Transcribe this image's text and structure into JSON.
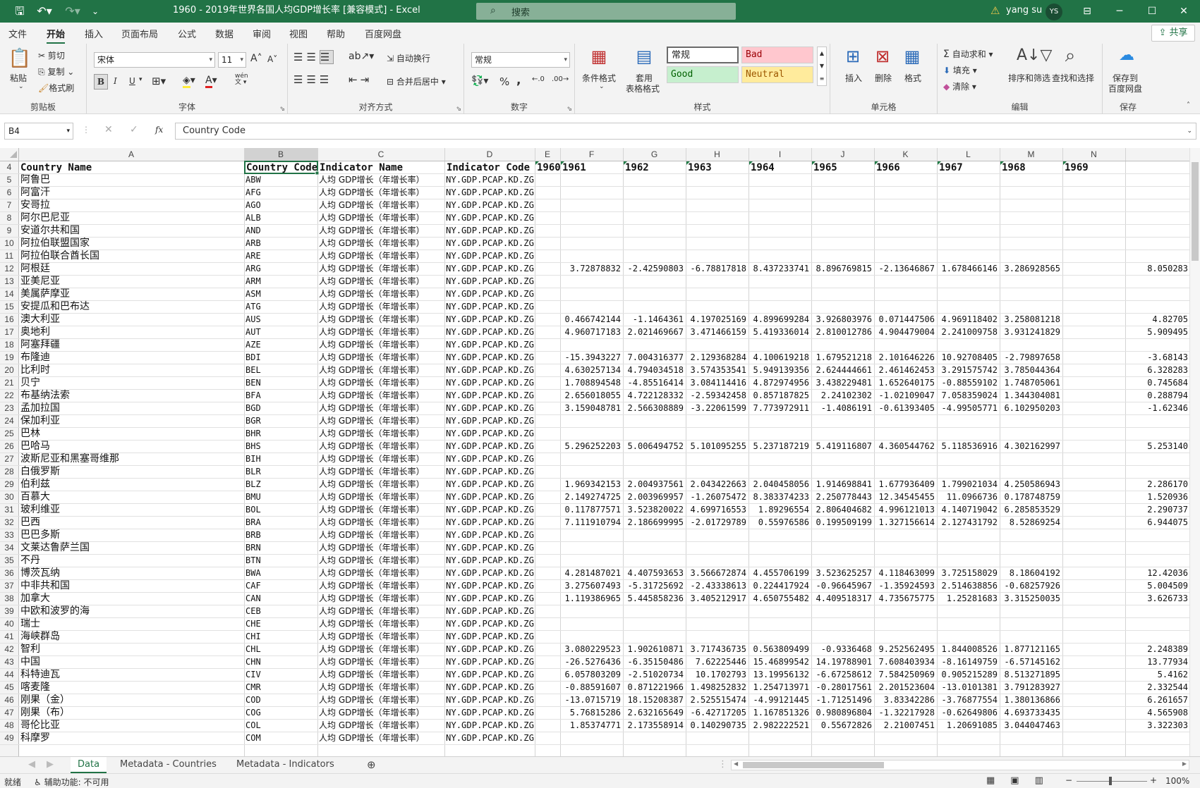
{
  "window": {
    "title": "1960 - 2019年世界各国人均GDP增长率  [兼容模式]  -  Excel",
    "search_placeholder": "搜索",
    "user_name": "yang su",
    "user_initials": "YS"
  },
  "ribbon_tabs": [
    "文件",
    "开始",
    "插入",
    "页面布局",
    "公式",
    "数据",
    "审阅",
    "视图",
    "帮助",
    "百度网盘"
  ],
  "share_label": "共享",
  "clipboard": {
    "paste": "粘贴",
    "cut": "剪切",
    "copy": "复制",
    "format_painter": "格式刷",
    "group": "剪贴板"
  },
  "font": {
    "name": "宋体",
    "size": "11",
    "group": "字体",
    "bold": "B",
    "italic": "I",
    "underline": "U",
    "wen": "wén"
  },
  "align": {
    "wrap": "自动换行",
    "merge": "合并后居中",
    "group": "对齐方式"
  },
  "number": {
    "format": "常规",
    "group": "数字",
    "percent": "%",
    "comma": ","
  },
  "styles": {
    "cond": "条件格式",
    "table1": "套用",
    "table2": "表格格式",
    "normal": "常规",
    "bad": "Bad",
    "good": "Good",
    "neutral": "Neutral",
    "group": "样式"
  },
  "cells": {
    "insert": "插入",
    "delete": "删除",
    "format": "格式",
    "group": "单元格"
  },
  "editing": {
    "autosum": "自动求和",
    "fill": "填充",
    "clear": "清除",
    "sort": "排序和筛选",
    "find": "查找和选择",
    "group": "编辑"
  },
  "save": {
    "l1": "保存到",
    "l2": "百度网盘",
    "group": "保存"
  },
  "formula": {
    "namebox": "B4",
    "fx": "fx",
    "content": "Country Code"
  },
  "colors": {
    "accent": "#217346"
  },
  "columns": [
    "A",
    "B",
    "C",
    "D",
    "E",
    "F",
    "G",
    "H",
    "I",
    "J",
    "K",
    "L",
    "M",
    "N"
  ],
  "header_row": {
    "num": "4",
    "cells": [
      "Country Name",
      "Country Code",
      "Indicator Name",
      "Indicator Code",
      "1960",
      "1961",
      "1962",
      "1963",
      "1964",
      "1965",
      "1966",
      "1967",
      "1968",
      "1969"
    ]
  },
  "indicator_name": "人均 GDP增长（年增长率）",
  "indicator_code": "NY.GDP.PCAP.KD.ZG",
  "rows": [
    {
      "n": "5",
      "name": "阿鲁巴",
      "code": "ABW",
      "v": []
    },
    {
      "n": "6",
      "name": "阿富汗",
      "code": "AFG",
      "v": []
    },
    {
      "n": "7",
      "name": "安哥拉",
      "code": "AGO",
      "v": []
    },
    {
      "n": "8",
      "name": "阿尔巴尼亚",
      "code": "ALB",
      "v": []
    },
    {
      "n": "9",
      "name": "安道尔共和国",
      "code": "AND",
      "v": []
    },
    {
      "n": "10",
      "name": "阿拉伯联盟国家",
      "code": "ARB",
      "v": []
    },
    {
      "n": "11",
      "name": "阿拉伯联合酋长国",
      "code": "ARE",
      "v": []
    },
    {
      "n": "12",
      "name": "阿根廷",
      "code": "ARG",
      "v": [
        "3.72878832",
        "-2.42590803",
        "-6.78817818",
        "8.437233741",
        "8.896769815",
        "-2.13646867",
        "1.678466146",
        "3.286928565",
        "8.050283"
      ]
    },
    {
      "n": "13",
      "name": "亚美尼亚",
      "code": "ARM",
      "v": []
    },
    {
      "n": "14",
      "name": "美属萨摩亚",
      "code": "ASM",
      "v": []
    },
    {
      "n": "15",
      "name": "安提瓜和巴布达",
      "code": "ATG",
      "v": []
    },
    {
      "n": "16",
      "name": "澳大利亚",
      "code": "AUS",
      "v": [
        "0.466742144",
        "-1.1464361",
        "4.197025169",
        "4.899699284",
        "3.926803976",
        "0.071447506",
        "4.969118402",
        "3.258081218",
        "4.82705"
      ]
    },
    {
      "n": "17",
      "name": "奥地利",
      "code": "AUT",
      "v": [
        "4.960717183",
        "2.021469667",
        "3.471466159",
        "5.419336014",
        "2.810012786",
        "4.904479004",
        "2.241009758",
        "3.931241829",
        "5.909495"
      ]
    },
    {
      "n": "18",
      "name": "阿塞拜疆",
      "code": "AZE",
      "v": []
    },
    {
      "n": "19",
      "name": "布隆迪",
      "code": "BDI",
      "v": [
        "-15.3943227",
        "7.004316377",
        "2.129368284",
        "4.100619218",
        "1.679521218",
        "2.101646226",
        "10.92708405",
        "-2.79897658",
        "-3.68143"
      ]
    },
    {
      "n": "20",
      "name": "比利时",
      "code": "BEL",
      "v": [
        "4.630257134",
        "4.794034518",
        "3.574353541",
        "5.949139356",
        "2.624444661",
        "2.461462453",
        "3.291575742",
        "3.785044364",
        "6.328283"
      ]
    },
    {
      "n": "21",
      "name": "贝宁",
      "code": "BEN",
      "v": [
        "1.708894548",
        "-4.85516414",
        "3.084114416",
        "4.872974956",
        "3.438229481",
        "1.652640175",
        "-0.88559102",
        "1.748705061",
        "0.745684"
      ]
    },
    {
      "n": "22",
      "name": "布基纳法索",
      "code": "BFA",
      "v": [
        "2.656018055",
        "4.722128332",
        "-2.59342458",
        "0.857187825",
        "2.24102302",
        "-1.02109047",
        "7.058359024",
        "1.344304081",
        "0.288794"
      ]
    },
    {
      "n": "23",
      "name": "孟加拉国",
      "code": "BGD",
      "v": [
        "3.159048781",
        "2.566308889",
        "-3.22061599",
        "7.773972911",
        "-1.4086191",
        "-0.61393405",
        "-4.99505771",
        "6.102950203",
        "-1.62346"
      ]
    },
    {
      "n": "24",
      "name": "保加利亚",
      "code": "BGR",
      "v": []
    },
    {
      "n": "25",
      "name": "巴林",
      "code": "BHR",
      "v": []
    },
    {
      "n": "26",
      "name": "巴哈马",
      "code": "BHS",
      "v": [
        "5.296252203",
        "5.006494752",
        "5.101095255",
        "5.237187219",
        "5.419116807",
        "4.360544762",
        "5.118536916",
        "4.302162997",
        "5.253140"
      ]
    },
    {
      "n": "27",
      "name": "波斯尼亚和黑塞哥维那",
      "code": "BIH",
      "v": []
    },
    {
      "n": "28",
      "name": "白俄罗斯",
      "code": "BLR",
      "v": []
    },
    {
      "n": "29",
      "name": "伯利兹",
      "code": "BLZ",
      "v": [
        "1.969342153",
        "2.004937561",
        "2.043422663",
        "2.040458056",
        "1.914698841",
        "1.677936409",
        "1.799021034",
        "4.250586943",
        "2.286170"
      ]
    },
    {
      "n": "30",
      "name": "百慕大",
      "code": "BMU",
      "v": [
        "2.149274725",
        "2.003969957",
        "-1.26075472",
        "8.383374233",
        "2.250778443",
        "12.34545455",
        "11.0966736",
        "0.178748759",
        "1.520936"
      ]
    },
    {
      "n": "31",
      "name": "玻利维亚",
      "code": "BOL",
      "v": [
        "0.117877571",
        "3.523820022",
        "4.699716553",
        "1.89296554",
        "2.806404682",
        "4.996121013",
        "4.140719042",
        "6.285853529",
        "2.290737"
      ]
    },
    {
      "n": "32",
      "name": "巴西",
      "code": "BRA",
      "v": [
        "7.111910794",
        "2.186699995",
        "-2.01729789",
        "0.55976586",
        "0.199509199",
        "1.327156614",
        "2.127431792",
        "8.52869254",
        "6.944075"
      ]
    },
    {
      "n": "33",
      "name": "巴巴多斯",
      "code": "BRB",
      "v": []
    },
    {
      "n": "34",
      "name": "文莱达鲁萨兰国",
      "code": "BRN",
      "v": []
    },
    {
      "n": "35",
      "name": "不丹",
      "code": "BTN",
      "v": []
    },
    {
      "n": "36",
      "name": "博茨瓦纳",
      "code": "BWA",
      "v": [
        "4.281487021",
        "4.407593653",
        "3.566672874",
        "4.455706199",
        "3.523625257",
        "4.118463099",
        "3.725158029",
        "8.18604192",
        "12.42036"
      ]
    },
    {
      "n": "37",
      "name": "中非共和国",
      "code": "CAF",
      "v": [
        "3.275607493",
        "-5.31725692",
        "-2.43338613",
        "0.224417924",
        "-0.96645967",
        "-1.35924593",
        "2.514638856",
        "-0.68257926",
        "5.004509"
      ]
    },
    {
      "n": "38",
      "name": "加拿大",
      "code": "CAN",
      "v": [
        "1.119386965",
        "5.445858236",
        "3.405212917",
        "4.650755482",
        "4.409518317",
        "4.735675775",
        "1.25281683",
        "3.315250035",
        "3.626733"
      ]
    },
    {
      "n": "39",
      "name": "中欧和波罗的海",
      "code": "CEB",
      "v": []
    },
    {
      "n": "40",
      "name": "瑞士",
      "code": "CHE",
      "v": []
    },
    {
      "n": "41",
      "name": "海峡群岛",
      "code": "CHI",
      "v": []
    },
    {
      "n": "42",
      "name": "智利",
      "code": "CHL",
      "v": [
        "3.080229523",
        "1.902610871",
        "3.717436735",
        "0.563809499",
        "-0.9336468",
        "9.252562495",
        "1.844008526",
        "1.877121165",
        "2.248389"
      ]
    },
    {
      "n": "43",
      "name": "中国",
      "code": "CHN",
      "v": [
        "-26.5276436",
        "-6.35150486",
        "7.62225446",
        "15.46899542",
        "14.19788901",
        "7.608403934",
        "-8.16149759",
        "-6.57145162",
        "13.77934"
      ]
    },
    {
      "n": "44",
      "name": "科特迪瓦",
      "code": "CIV",
      "v": [
        "6.057803209",
        "-2.51020734",
        "10.1702793",
        "13.19956132",
        "-6.67258612",
        "7.584250969",
        "0.905215289",
        "8.513271895",
        "5.4162"
      ]
    },
    {
      "n": "45",
      "name": "喀麦隆",
      "code": "CMR",
      "v": [
        "-0.88591607",
        "0.871221966",
        "1.498252832",
        "1.254713971",
        "-0.28017561",
        "2.201523604",
        "-13.0101381",
        "3.791283927",
        "2.332544"
      ]
    },
    {
      "n": "46",
      "name": "刚果（金）",
      "code": "COD",
      "v": [
        "-13.0715719",
        "18.15208387",
        "2.525515474",
        "-4.99121445",
        "-1.71251496",
        "3.83342286",
        "-3.76877554",
        "1.380136866",
        "6.261657"
      ]
    },
    {
      "n": "47",
      "name": "刚果（布）",
      "code": "COG",
      "v": [
        "5.76815286",
        "2.632165649",
        "-6.42717205",
        "1.167851326",
        "0.980896804",
        "-1.32217928",
        "-0.62649806",
        "4.693733435",
        "4.565908"
      ]
    },
    {
      "n": "48",
      "name": "哥伦比亚",
      "code": "COL",
      "v": [
        "1.85374771",
        "2.173558914",
        "0.140290735",
        "2.982222521",
        "0.55672826",
        "2.21007451",
        "1.20691085",
        "3.044047463",
        "3.322303"
      ]
    },
    {
      "n": "49",
      "name": "科摩罗",
      "code": "COM",
      "v": []
    }
  ],
  "sheet_tabs": [
    "Data",
    "Metadata - Countries",
    "Metadata - Indicators"
  ],
  "status": {
    "ready": "就绪",
    "accessibility": "辅助功能: 不可用",
    "zoom": "100%"
  }
}
